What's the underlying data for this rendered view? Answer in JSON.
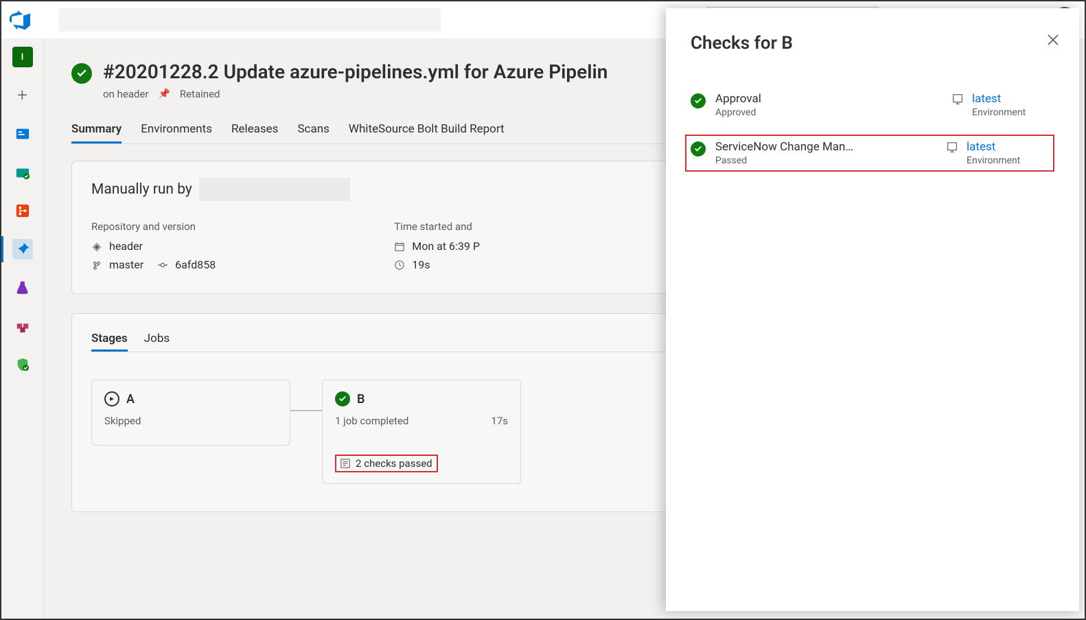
{
  "page": {
    "title": "#20201228.2 Update azure-pipelines.yml for Azure Pipelin",
    "branchLabel": "on header",
    "retained": "Retained"
  },
  "tabs": {
    "items": [
      "Summary",
      "Environments",
      "Releases",
      "Scans",
      "WhiteSource Bolt Build Report"
    ],
    "active": "Summary"
  },
  "runInfo": {
    "heading": "Manually run by",
    "repoSection": "Repository and version",
    "repoName": "header",
    "branchName": "master",
    "commit": "6afd858",
    "timeSection": "Time started and",
    "startTime": "Mon at 6:39 P",
    "duration": "19s"
  },
  "stagesSection": {
    "tabs": [
      "Stages",
      "Jobs"
    ],
    "active": "Stages",
    "stageA": {
      "name": "A",
      "status": "Skipped"
    },
    "stageB": {
      "name": "B",
      "status": "1 job completed",
      "duration": "17s",
      "checks": "2 checks passed"
    }
  },
  "panel": {
    "title": "Checks for B",
    "checks": [
      {
        "name": "Approval",
        "status": "Approved",
        "envLink": "latest",
        "envType": "Environment"
      },
      {
        "name": "ServiceNow Change Mana…",
        "status": "Passed",
        "envLink": "latest",
        "envType": "Environment"
      }
    ]
  }
}
